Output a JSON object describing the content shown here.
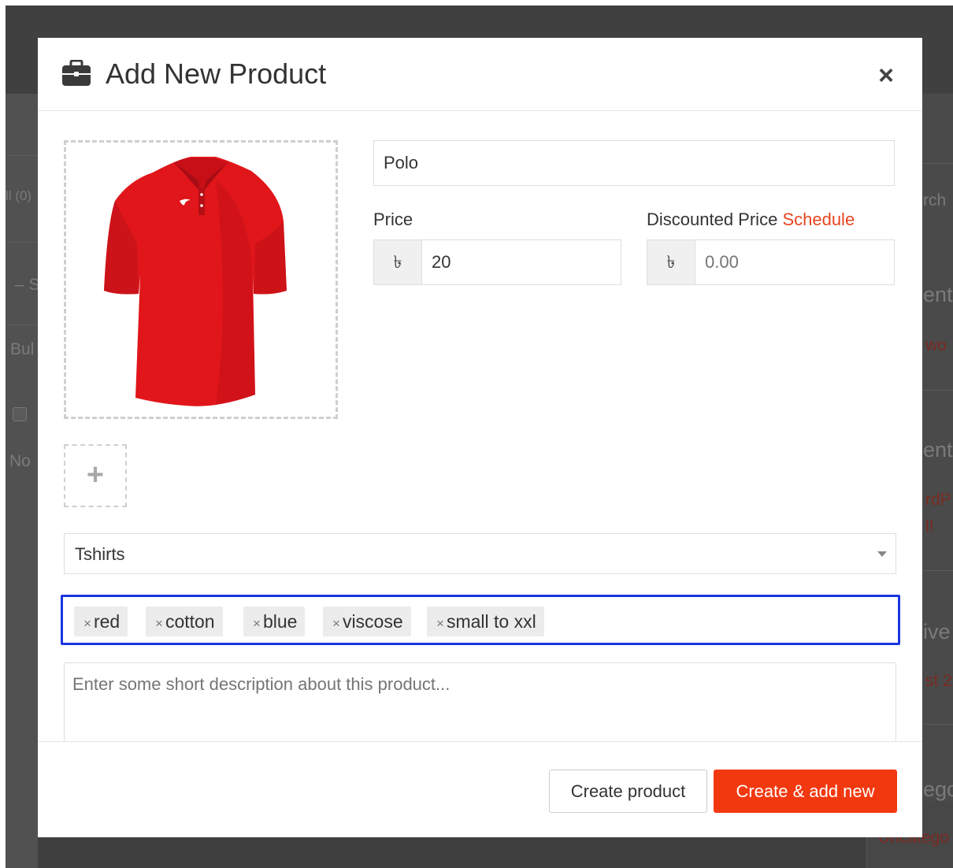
{
  "background": {
    "left_fragments": [
      "ll (0)",
      "– S",
      "Bul",
      "No"
    ],
    "right_fragments": [
      "rch",
      "ent",
      "wo",
      "ent",
      "rdP",
      "l!",
      "ive",
      "st 2",
      "ego",
      "Uncatego"
    ]
  },
  "modal": {
    "title": "Add New Product",
    "title_icon": "briefcase-icon",
    "close_label": "×"
  },
  "form": {
    "product_name": "Polo",
    "price_label": "Price",
    "currency_symbol": "৳",
    "price_value": "20",
    "discount_label": "Discounted Price",
    "schedule_link": "Schedule",
    "discount_placeholder": "0.00",
    "category": "Tshirts",
    "tags": [
      "red",
      "cotton",
      "blue",
      "viscose",
      "small to xxl"
    ],
    "tag_remove_symbol": "×",
    "description_placeholder": "Enter some short description about this product...",
    "add_image_symbol": "+"
  },
  "footer": {
    "create_label": "Create product",
    "create_add_label": "Create & add new"
  },
  "colors": {
    "accent": "#f2380f",
    "tags_focus_border": "#1a35e0",
    "product_red": "#e0161a"
  }
}
